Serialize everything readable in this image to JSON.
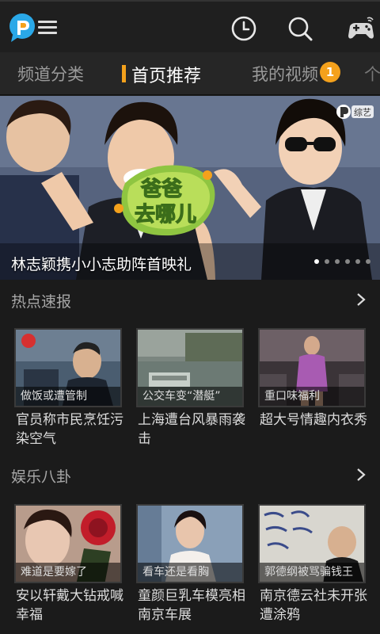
{
  "header": {
    "icons": [
      "pptv-logo-icon",
      "menu-icon",
      "history-clock-icon",
      "search-icon",
      "gamepad-icon"
    ]
  },
  "tabs": [
    {
      "label": "频道分类",
      "active": false
    },
    {
      "label": "首页推荐",
      "active": true
    },
    {
      "label": "我的视频",
      "active": false,
      "badge": "1"
    },
    {
      "label": "个",
      "active": false
    }
  ],
  "banner": {
    "caption": "林志颖携小小志助阵首映礼",
    "logo_text": "爸爸去哪儿",
    "tag": "综艺",
    "dots": 6,
    "active_dot": 0
  },
  "sections": [
    {
      "title": "热点速报",
      "items": [
        {
          "thumb_caption": "做饭或遭管制",
          "title": "官员称市民烹饪污染空气"
        },
        {
          "thumb_caption": "公交车变“潜艇”",
          "title": "上海遭台风暴雨袭击"
        },
        {
          "thumb_caption": "重口味福利",
          "title": "超大号情趣内衣秀"
        }
      ]
    },
    {
      "title": "娱乐八卦",
      "items": [
        {
          "thumb_caption": "难道是要嫁了",
          "title": "安以轩戴大钻戒喊幸福"
        },
        {
          "thumb_caption": "看车还是看胸",
          "title": "童颜巨乳车模亮相南京车展"
        },
        {
          "thumb_caption": "郭德纲被骂骗钱王",
          "title": "南京德云社未开张遭涂鸦"
        }
      ]
    }
  ],
  "colors": {
    "accent": "#f4a11c",
    "background": "#1b1b1b",
    "logo_blue": "#2aa8e8"
  }
}
